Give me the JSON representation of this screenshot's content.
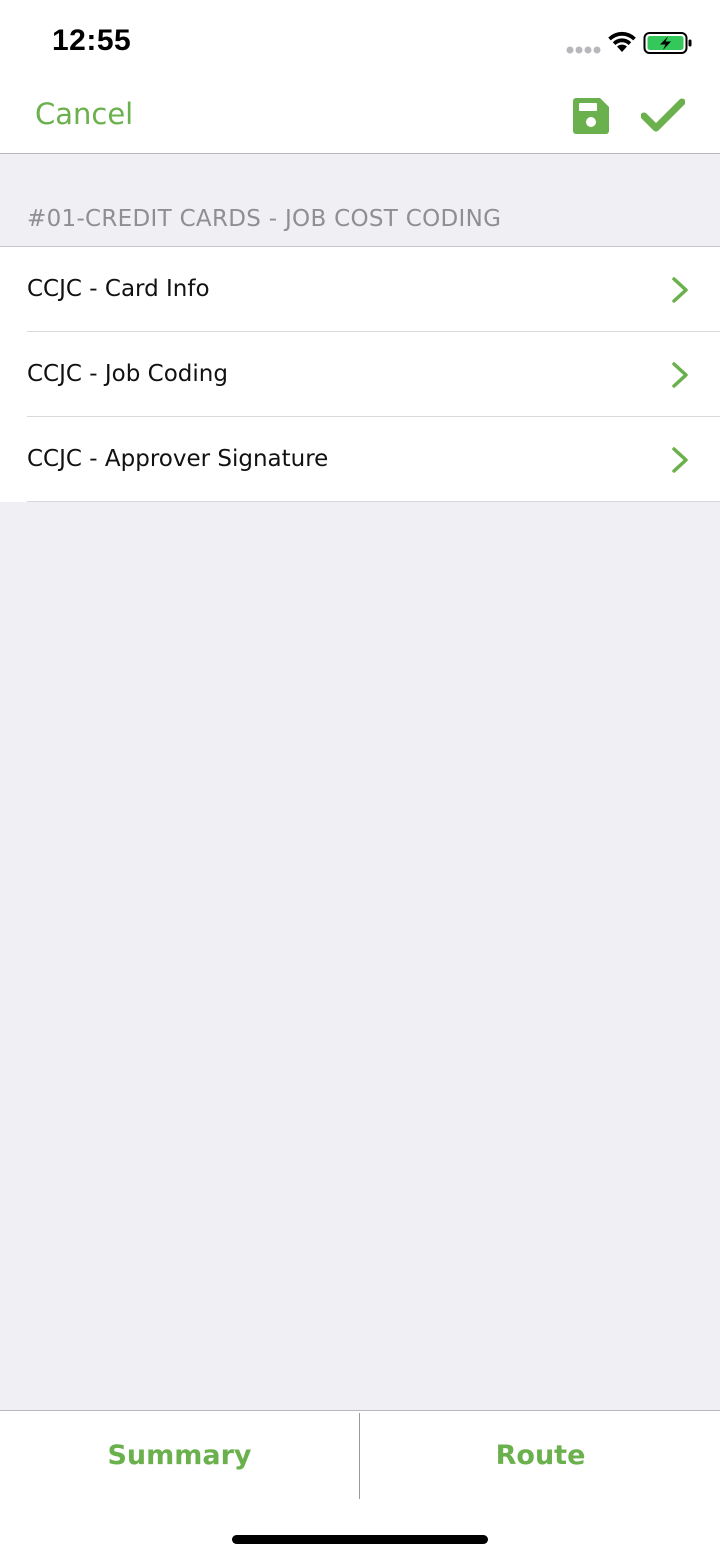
{
  "status_bar": {
    "time": "12:55"
  },
  "nav": {
    "cancel_label": "Cancel",
    "save_icon": "floppy-disk-icon",
    "done_icon": "checkmark-icon"
  },
  "section": {
    "header": "#01-CREDIT CARDS - JOB COST CODING",
    "items": [
      {
        "label": "CCJC - Card Info"
      },
      {
        "label": "CCJC - Job Coding"
      },
      {
        "label": "CCJC - Approver Signature"
      }
    ]
  },
  "toolbar": {
    "summary_label": "Summary",
    "route_label": "Route"
  },
  "colors": {
    "accent": "#6ab04c",
    "background": "#efeff4",
    "header_text": "#8e8e93"
  }
}
